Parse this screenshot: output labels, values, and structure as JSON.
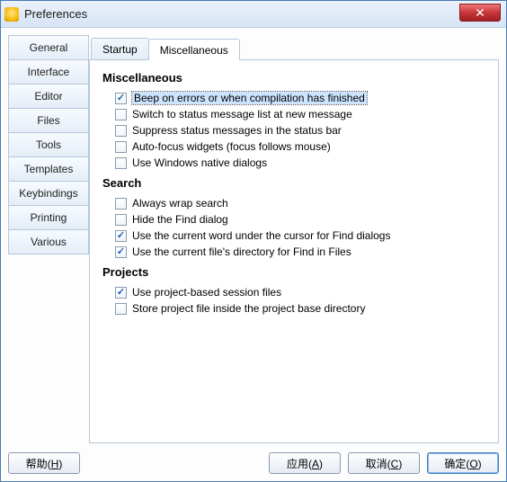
{
  "window": {
    "title": "Preferences"
  },
  "sidebar": {
    "items": [
      {
        "label": "General"
      },
      {
        "label": "Interface"
      },
      {
        "label": "Editor"
      },
      {
        "label": "Files"
      },
      {
        "label": "Tools"
      },
      {
        "label": "Templates"
      },
      {
        "label": "Keybindings"
      },
      {
        "label": "Printing"
      },
      {
        "label": "Various"
      }
    ]
  },
  "tabs": {
    "items": [
      {
        "label": "Startup"
      },
      {
        "label": "Miscellaneous"
      }
    ]
  },
  "groups": {
    "misc": {
      "title": "Miscellaneous",
      "items": [
        {
          "label": "Beep on errors or when compilation has finished",
          "checked": true,
          "highlight": true
        },
        {
          "label": "Switch to status message list at new message",
          "checked": false
        },
        {
          "label": "Suppress status messages in the status bar",
          "checked": false
        },
        {
          "label": "Auto-focus widgets (focus follows mouse)",
          "checked": false
        },
        {
          "label": "Use Windows native dialogs",
          "checked": false
        }
      ]
    },
    "search": {
      "title": "Search",
      "items": [
        {
          "label": "Always wrap search",
          "checked": false
        },
        {
          "label": "Hide the Find dialog",
          "checked": false
        },
        {
          "label": "Use the current word under the cursor for Find dialogs",
          "checked": true
        },
        {
          "label": "Use the current file's directory for Find in Files",
          "checked": true
        }
      ]
    },
    "projects": {
      "title": "Projects",
      "items": [
        {
          "label": "Use project-based session files",
          "checked": true
        },
        {
          "label": "Store project file inside the project base directory",
          "checked": false
        }
      ]
    }
  },
  "buttons": {
    "help": {
      "text": "帮助",
      "mn": "H"
    },
    "apply": {
      "text": "应用",
      "mn": "A"
    },
    "cancel": {
      "text": "取消",
      "mn": "C"
    },
    "ok": {
      "text": "确定",
      "mn": "O"
    }
  }
}
